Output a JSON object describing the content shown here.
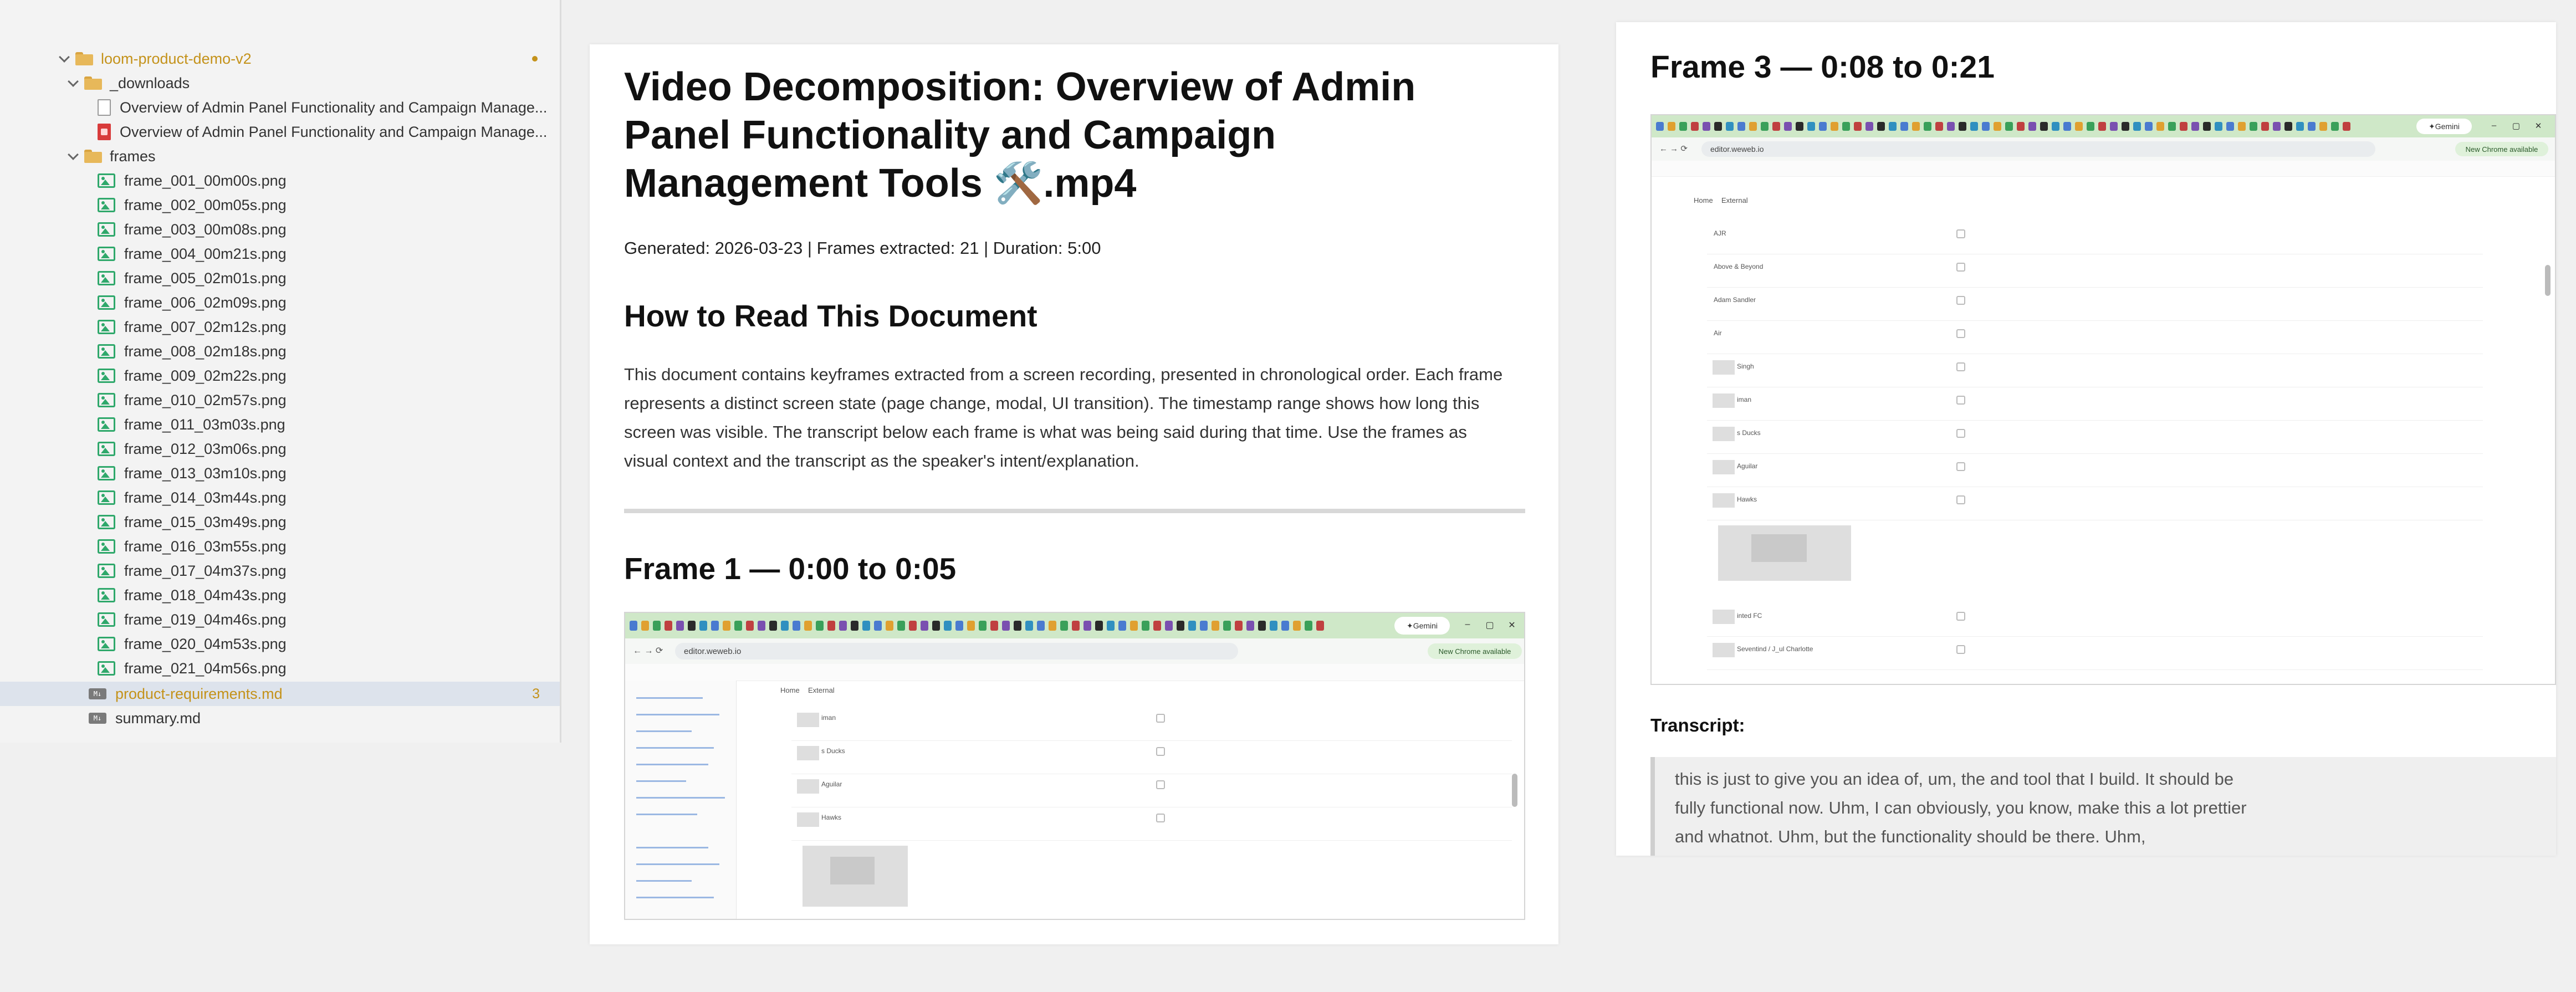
{
  "explorer": {
    "root": "loom-product-demo-v2",
    "downloads_folder": "_downloads",
    "downloads_files": [
      "Overview of Admin Panel Functionality and Campaign Manage...",
      "Overview of Admin Panel Functionality and Campaign Manage..."
    ],
    "frames_folder": "frames",
    "frame_files": [
      "frame_001_00m00s.png",
      "frame_002_00m05s.png",
      "frame_003_00m08s.png",
      "frame_004_00m21s.png",
      "frame_005_02m01s.png",
      "frame_006_02m09s.png",
      "frame_007_02m12s.png",
      "frame_008_02m18s.png",
      "frame_009_02m22s.png",
      "frame_010_02m57s.png",
      "frame_011_03m03s.png",
      "frame_012_03m06s.png",
      "frame_013_03m10s.png",
      "frame_014_03m44s.png",
      "frame_015_03m49s.png",
      "frame_016_03m55s.png",
      "frame_017_04m37s.png",
      "frame_018_04m43s.png",
      "frame_019_04m46s.png",
      "frame_020_04m53s.png",
      "frame_021_04m56s.png"
    ],
    "selected_file": "product-requirements.md",
    "selected_badge": "3",
    "summary_file": "summary.md",
    "colors": {
      "git_modified": "#c4921a",
      "selection": "#dde3ec"
    }
  },
  "document": {
    "title": "Video Decomposition: Overview of Admin Panel Functionality and Campaign Management Tools 🛠️.mp4",
    "meta": "Generated: 2026-03-23 | Frames extracted: 21 | Duration: 5:00",
    "howto_heading": "How to Read This Document",
    "howto_text": "This document contains keyframes extracted from a screen recording, presented in chronological order. Each frame represents a distinct screen state (page change, modal, UI transition). The timestamp range shows how long this screen was visible. The transcript below each frame is what was being said during that time. Use the frames as visual context and the transcript as the speaker's intent/explanation.",
    "frame1_heading": "Frame 1 — 0:00 to 0:05"
  },
  "frame3": {
    "heading": "Frame 3 — 0:08 to 0:21",
    "transcript_label": "Transcript:",
    "transcript": "this is just to give you an idea of, um, the and tool that I build. It should be fully functional now. Uhm, I can obviously, you know, make this a lot prettier and whatnot. Uhm, but the functionality should be there. Uhm,"
  },
  "screenshot": {
    "gemini": "Gemini",
    "url": "editor.weweb.io",
    "new_chrome": "New Chrome available",
    "page_tabs": [
      "Home",
      "External"
    ],
    "rows_frame1": [
      "iman",
      "s Ducks",
      "Aguilar",
      "Hawks"
    ],
    "rows_frame3": [
      "AJR",
      "Above & Beyond",
      "Adam Sandler",
      "Air",
      "Singh",
      "iman",
      "s Ducks",
      "Aguilar",
      "Hawks",
      "inted FC",
      "Seventind / J_ul Charlotte"
    ],
    "tabbar_color": "#cfe8c8"
  }
}
